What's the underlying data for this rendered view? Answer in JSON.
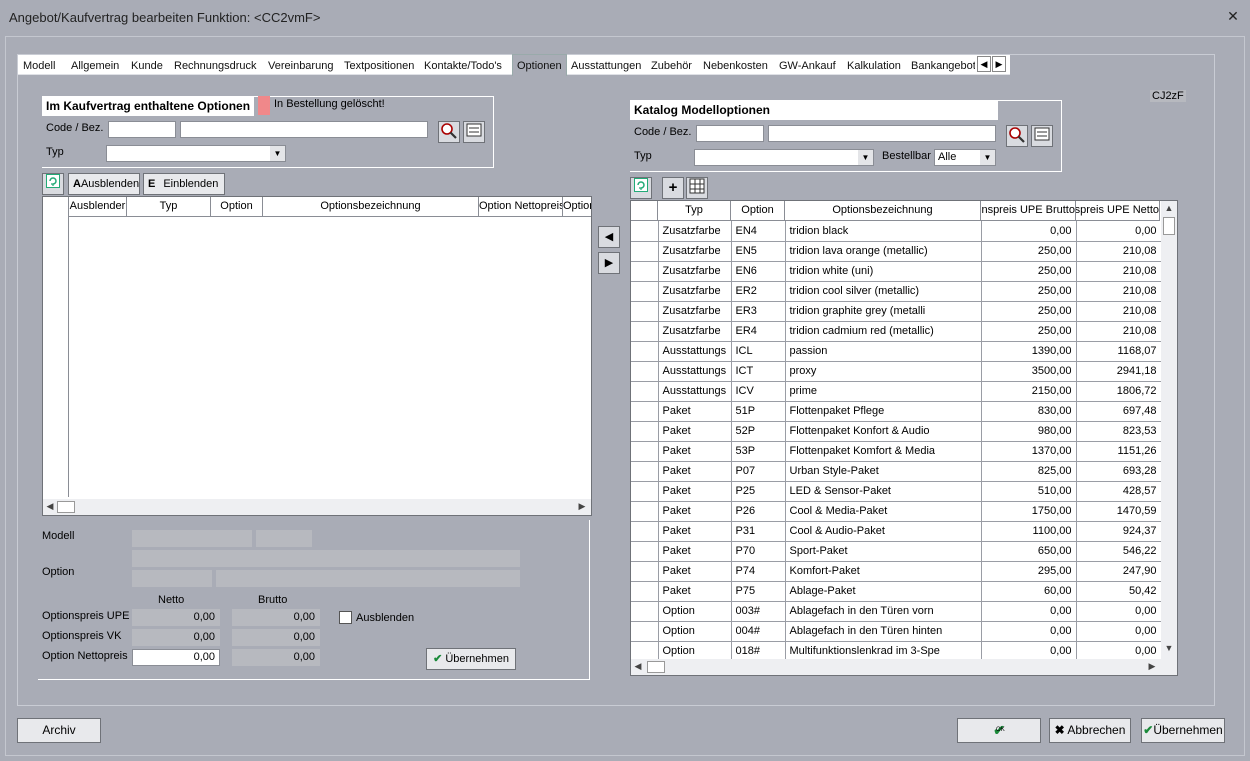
{
  "window": {
    "title": "Angebot/Kaufvertrag bearbeiten    Funktion: <CC2vmF>",
    "close_glyph": "✕"
  },
  "tabs": [
    "Modell",
    "Allgemein",
    "Kunde",
    "Rechnungsdruck",
    "Vereinbarung",
    "Textpositionen",
    "Kontakte/Todo's",
    "Optionen",
    "Ausstattungen",
    "Zubehör",
    "Nebenkosten",
    "GW-Ankauf",
    "Kalkulation",
    "Bankangebot"
  ],
  "active_tab": "Optionen",
  "left": {
    "title": "Im Kaufvertrag enthaltene Optionen",
    "legend_color": "#f0888a",
    "legend_text": "In Bestellung gelöscht!",
    "code_label": "Code / Bez.",
    "typ_label": "Typ",
    "btn_ausblenden": "Ausblenden",
    "btn_einblenden": "Einblenden",
    "einblenden_glyph": "E",
    "ausblenden_glyph": "A",
    "columns": [
      "Ausblender",
      "Typ",
      "Option",
      "Optionsbezeichnung",
      "Option Nettopreis",
      "Option"
    ]
  },
  "details": {
    "modell_label": "Modell",
    "option_label": "Option",
    "netto_header": "Netto",
    "brutto_header": "Brutto",
    "rows": [
      {
        "label": "Optionspreis UPE",
        "netto": "0,00",
        "brutto": "0,00"
      },
      {
        "label": "Optionspreis VK",
        "netto": "0,00",
        "brutto": "0,00"
      },
      {
        "label": "Option Nettopreis",
        "netto": "0,00",
        "brutto": "0,00"
      }
    ],
    "ausblenden_checkbox": "Ausblenden",
    "uebernehmen": "Übernehmen"
  },
  "right": {
    "code_badge": "CJ2zF",
    "title": "Katalog Modelloptionen",
    "code_label": "Code / Bez.",
    "typ_label": "Typ",
    "bestellbar_label": "Bestellbar",
    "bestellbar_value": "Alle",
    "columns": [
      "Typ",
      "Option",
      "Optionsbezeichnung",
      "Optionspreis UPE Brutto",
      "Optionspreis UPE Netto"
    ],
    "rows": [
      [
        "Zusatzfarbe",
        "EN4",
        "tridion black",
        "0,00",
        "0,00"
      ],
      [
        "Zusatzfarbe",
        "EN5",
        "tridion lava orange (metallic)",
        "250,00",
        "210,08"
      ],
      [
        "Zusatzfarbe",
        "EN6",
        "tridion white (uni)",
        "250,00",
        "210,08"
      ],
      [
        "Zusatzfarbe",
        "ER2",
        "tridion cool silver (metallic)",
        "250,00",
        "210,08"
      ],
      [
        "Zusatzfarbe",
        "ER3",
        "tridion graphite grey (metalli",
        "250,00",
        "210,08"
      ],
      [
        "Zusatzfarbe",
        "ER4",
        "tridion cadmium red (metallic)",
        "250,00",
        "210,08"
      ],
      [
        "Ausstattungs",
        "ICL",
        "passion",
        "1390,00",
        "1168,07"
      ],
      [
        "Ausstattungs",
        "ICT",
        "proxy",
        "3500,00",
        "2941,18"
      ],
      [
        "Ausstattungs",
        "ICV",
        "prime",
        "2150,00",
        "1806,72"
      ],
      [
        "Paket",
        "51P",
        "Flottenpaket Pflege",
        "830,00",
        "697,48"
      ],
      [
        "Paket",
        "52P",
        "Flottenpaket Konfort & Audio",
        "980,00",
        "823,53"
      ],
      [
        "Paket",
        "53P",
        "Flottenpaket Komfort & Media",
        "1370,00",
        "1151,26"
      ],
      [
        "Paket",
        "P07",
        "Urban Style-Paket",
        "825,00",
        "693,28"
      ],
      [
        "Paket",
        "P25",
        "LED & Sensor-Paket",
        "510,00",
        "428,57"
      ],
      [
        "Paket",
        "P26",
        "Cool & Media-Paket",
        "1750,00",
        "1470,59"
      ],
      [
        "Paket",
        "P31",
        "Cool & Audio-Paket",
        "1100,00",
        "924,37"
      ],
      [
        "Paket",
        "P70",
        "Sport-Paket",
        "650,00",
        "546,22"
      ],
      [
        "Paket",
        "P74",
        "Komfort-Paket",
        "295,00",
        "247,90"
      ],
      [
        "Paket",
        "P75",
        "Ablage-Paket",
        "60,00",
        "50,42"
      ],
      [
        "Option",
        "003#",
        "Ablagefach in den Türen vorn",
        "0,00",
        "0,00"
      ],
      [
        "Option",
        "004#",
        "Ablagefach in den Türen hinten",
        "0,00",
        "0,00"
      ],
      [
        "Option",
        "018#",
        "Multifunktionslenkrad im 3-Spe",
        "0,00",
        "0,00"
      ]
    ]
  },
  "footer": {
    "archiv": "Archiv",
    "ok_glyph": "OK",
    "abbrechen": "Abbrechen",
    "uebernehmen": "Übernehmen"
  }
}
